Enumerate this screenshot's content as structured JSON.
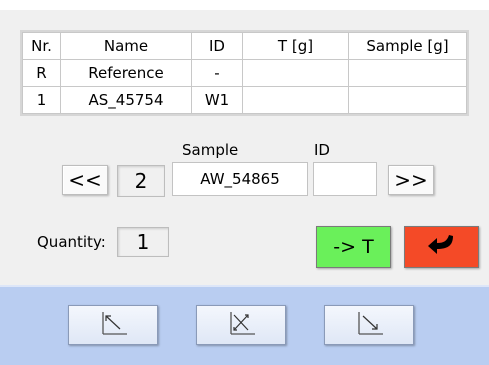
{
  "table": {
    "headers": [
      "Nr.",
      "Name",
      "ID",
      "T [g]",
      "Sample [g]"
    ],
    "rows": [
      [
        "R",
        "Reference",
        "-",
        "",
        ""
      ],
      [
        "1",
        "AS_45754",
        "W1",
        "",
        ""
      ]
    ]
  },
  "sample_nav": {
    "sample_label": "Sample",
    "id_label": "ID",
    "prev_label": "<<",
    "next_label": ">>",
    "index": "2",
    "sample_value": "AW_54865",
    "id_value": ""
  },
  "quantity": {
    "label": "Quantity:",
    "value": "1"
  },
  "actions": {
    "tare_label": "-> T"
  },
  "colors": {
    "tare_button": "#6af05a",
    "back_button": "#f44a27",
    "bottom_bar": "#b9cdf1"
  },
  "icons": {
    "back": "return-arrow-icon",
    "tool_1": "arrow-up-left-icon",
    "tool_2": "arrow-cross-icon",
    "tool_3": "arrow-down-right-icon"
  }
}
